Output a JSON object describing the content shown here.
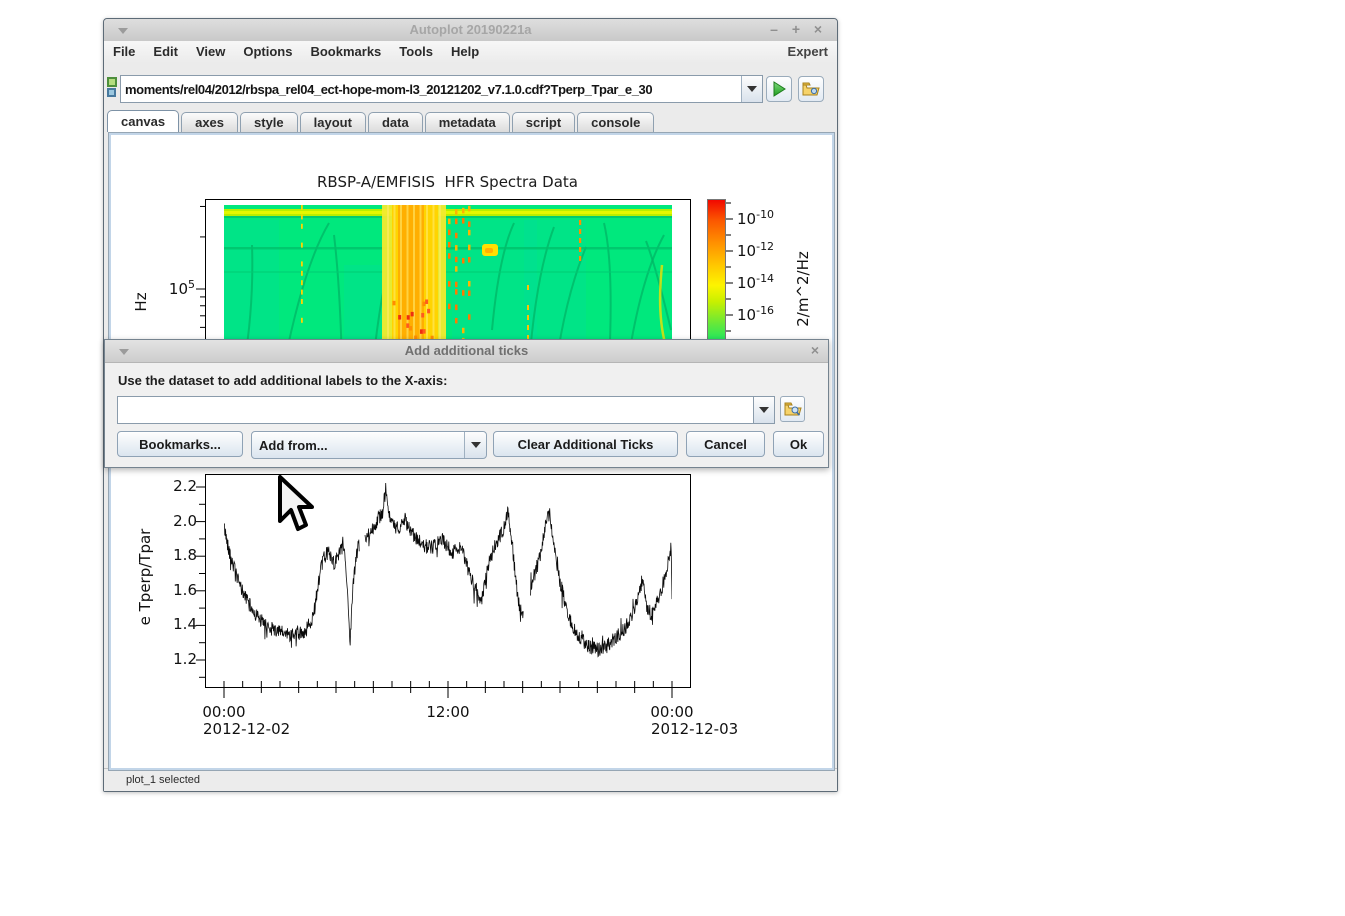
{
  "window": {
    "title": "Autoplot 20190221a",
    "window_buttons": {
      "minimize": "–",
      "maximize": "+",
      "close": "×"
    },
    "menu": {
      "items": [
        "File",
        "Edit",
        "View",
        "Options",
        "Bookmarks",
        "Tools",
        "Help"
      ],
      "right": "Expert"
    },
    "toolbar": {
      "address": "moments/rel04/2012/rbspa_rel04_ect-hope-mom-l3_20121202_v7.1.0.cdf?Tperp_Tpar_e_30"
    },
    "tabs": {
      "items": [
        "canvas",
        "axes",
        "style",
        "layout",
        "data",
        "metadata",
        "script",
        "console"
      ],
      "selected": "canvas"
    },
    "statusbar": "plot_1 selected"
  },
  "dialog": {
    "title": "Add additional ticks",
    "close": "×",
    "prompt": "Use the dataset to add additional labels to the X-axis:",
    "input_value": "",
    "buttons": {
      "bookmarks": "Bookmarks...",
      "add_from": "Add from...",
      "clear": "Clear Additional Ticks",
      "cancel": "Cancel",
      "ok": "Ok"
    }
  },
  "chart_data": [
    {
      "type": "heatmap",
      "title": "RBSP-A/EMFISIS  HFR Spectra Data",
      "ylabel": "Hz",
      "y_scale": "log",
      "y_tick": {
        "base": "10",
        "exp": "5"
      },
      "colorbar": {
        "ticks": [
          {
            "base": "10",
            "exp": "-10"
          },
          {
            "base": "10",
            "exp": "-12"
          },
          {
            "base": "10",
            "exp": "-14"
          },
          {
            "base": "10",
            "exp": "-16"
          }
        ],
        "label": "2/m^2/Hz",
        "top_color": "#f10800",
        "mid_color": "#fdf400",
        "bottom_color": "#00e87d"
      }
    },
    {
      "type": "line",
      "ylabel": "e Tperp/Tpar",
      "yticks": [
        2.2,
        2.0,
        1.8,
        1.6,
        1.4,
        1.2
      ],
      "ylim": [
        1.05,
        2.28
      ],
      "xlim_hours": [
        0,
        24
      ],
      "xticks": [
        {
          "label": "00:00",
          "date": "2012-12-02",
          "hour": 0
        },
        {
          "label": "12:00",
          "hour": 12
        },
        {
          "label": "00:00",
          "date": "2012-12-03",
          "hour": 24
        }
      ],
      "noise_amplitude": 0.042,
      "gaps": [
        [
          7.25,
          7.55
        ],
        [
          16.05,
          16.4
        ]
      ],
      "keypoints": [
        [
          0,
          1.97
        ],
        [
          0.3,
          1.82
        ],
        [
          0.8,
          1.64
        ],
        [
          1.5,
          1.49
        ],
        [
          2.2,
          1.4
        ],
        [
          3,
          1.36
        ],
        [
          3.8,
          1.34
        ],
        [
          4.4,
          1.37
        ],
        [
          4.8,
          1.46
        ],
        [
          5.1,
          1.68
        ],
        [
          5.35,
          1.79
        ],
        [
          5.6,
          1.83
        ],
        [
          5.9,
          1.76
        ],
        [
          6.2,
          1.82
        ],
        [
          6.45,
          1.86
        ],
        [
          6.6,
          1.6
        ],
        [
          6.75,
          1.3
        ],
        [
          6.9,
          1.62
        ],
        [
          7.1,
          1.8
        ],
        [
          7.2,
          1.86
        ],
        [
          7.6,
          1.89
        ],
        [
          8,
          1.97
        ],
        [
          8.5,
          2.06
        ],
        [
          8.68,
          2.2
        ],
        [
          8.8,
          2.04
        ],
        [
          9.2,
          1.95
        ],
        [
          9.7,
          2.01
        ],
        [
          10.2,
          1.91
        ],
        [
          10.7,
          1.86
        ],
        [
          11.2,
          1.85
        ],
        [
          11.7,
          1.9
        ],
        [
          12.2,
          1.82
        ],
        [
          12.7,
          1.86
        ],
        [
          13.1,
          1.71
        ],
        [
          13.5,
          1.61
        ],
        [
          13.8,
          1.54
        ],
        [
          14.2,
          1.76
        ],
        [
          14.6,
          1.88
        ],
        [
          15,
          1.96
        ],
        [
          15.2,
          2.07
        ],
        [
          15.45,
          1.86
        ],
        [
          15.7,
          1.6
        ],
        [
          15.9,
          1.44
        ],
        [
          16.5,
          1.64
        ],
        [
          16.9,
          1.79
        ],
        [
          17.25,
          2
        ],
        [
          17.45,
          2.04
        ],
        [
          17.7,
          1.84
        ],
        [
          17.95,
          1.68
        ],
        [
          18.25,
          1.54
        ],
        [
          18.6,
          1.41
        ],
        [
          19,
          1.33
        ],
        [
          19.5,
          1.28
        ],
        [
          20,
          1.26
        ],
        [
          20.5,
          1.28
        ],
        [
          21,
          1.33
        ],
        [
          21.5,
          1.39
        ],
        [
          21.9,
          1.46
        ],
        [
          22.2,
          1.56
        ],
        [
          22.4,
          1.66
        ],
        [
          22.65,
          1.51
        ],
        [
          22.9,
          1.46
        ],
        [
          23.2,
          1.53
        ],
        [
          23.5,
          1.63
        ],
        [
          23.8,
          1.76
        ],
        [
          23.95,
          1.86
        ],
        [
          24,
          1.56
        ]
      ]
    }
  ]
}
